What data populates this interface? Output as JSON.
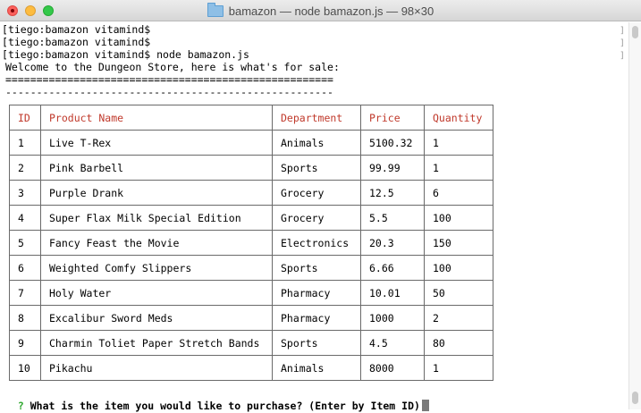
{
  "window": {
    "title": "bamazon — node bamazon.js — 98×30"
  },
  "terminal": {
    "history": [
      "tiego:bamazon vitamind$",
      "tiego:bamazon vitamind$",
      "tiego:bamazon vitamind$ node bamazon.js"
    ],
    "welcome": "Welcome to the Dungeon Store, here is what's for sale:",
    "divider_double": "=====================================================",
    "divider_single": "-----------------------------------------------------",
    "table": {
      "headers": [
        "ID",
        "Product Name",
        "Department",
        "Price",
        "Quantity"
      ],
      "rows": [
        [
          "1",
          "Live T-Rex",
          "Animals",
          "5100.32",
          "1"
        ],
        [
          "2",
          "Pink Barbell",
          "Sports",
          "99.99",
          "1"
        ],
        [
          "3",
          "Purple Drank",
          "Grocery",
          "12.5",
          "6"
        ],
        [
          "4",
          "Super Flax Milk Special Edition",
          "Grocery",
          "5.5",
          "100"
        ],
        [
          "5",
          "Fancy Feast the Movie",
          "Electronics",
          "20.3",
          "150"
        ],
        [
          "6",
          "Weighted Comfy Slippers",
          "Sports",
          "6.66",
          "100"
        ],
        [
          "7",
          "Holy Water",
          "Pharmacy",
          "10.01",
          "50"
        ],
        [
          "8",
          "Excalibur Sword Meds",
          "Pharmacy",
          "1000",
          "2"
        ],
        [
          "9",
          "Charmin Toliet Paper Stretch Bands",
          "Sports",
          "4.5",
          "80"
        ],
        [
          "10",
          "Pikachu",
          "Animals",
          "8000",
          "1"
        ]
      ]
    },
    "prompt": {
      "marker": "?",
      "question": "What is the item you would like to purchase? (Enter by Item ID)"
    }
  },
  "colors": {
    "header_text": "#c0392b",
    "prompt_marker": "#2fa82f"
  }
}
